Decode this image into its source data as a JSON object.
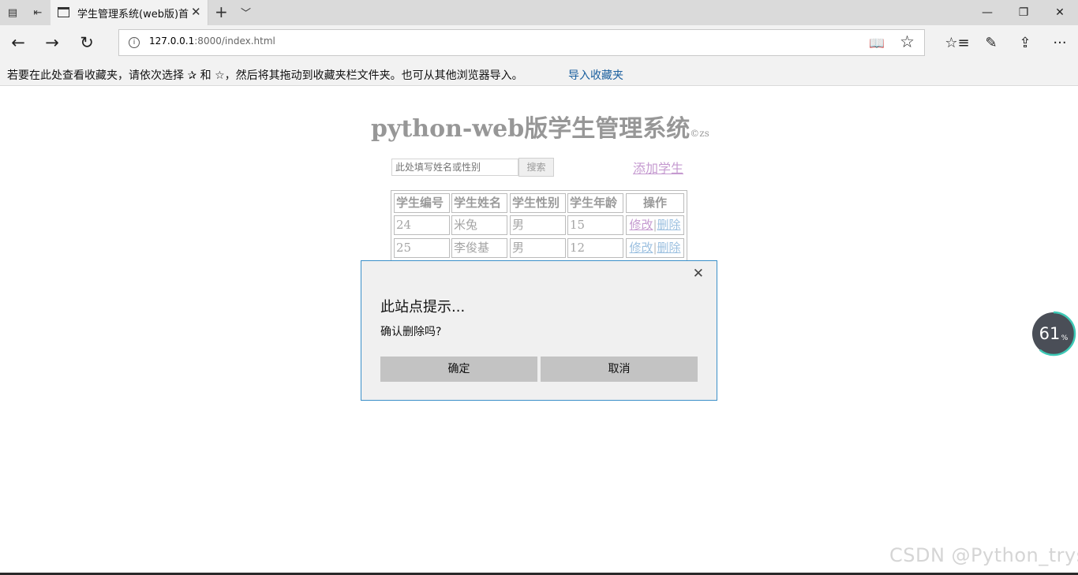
{
  "browser": {
    "tab_title": "学生管理系统(web版)首",
    "url_host": "127.0.0.1",
    "url_rest": ":8000/index.html",
    "address_info_icon": "i"
  },
  "favorites_bar": {
    "text": "若要在此处查看收藏夹，请依次选择 ✰ 和 ☆，然后将其拖动到收藏夹栏文件夹。也可从其他浏览器导入。",
    "import_link": "导入收藏夹"
  },
  "page": {
    "title": "python-web版学生管理系统",
    "title_suffix": "©zs",
    "search_placeholder": "此处填写姓名或性别",
    "search_button": "搜索",
    "add_student_link": "添加学生",
    "table": {
      "headers": [
        "学生编号",
        "学生姓名",
        "学生性别",
        "学生年龄",
        "操作"
      ],
      "rows": [
        {
          "id": "24",
          "name": "米兔",
          "gender": "男",
          "age": "15",
          "edit": "修改",
          "delete": "删除"
        },
        {
          "id": "25",
          "name": "李俊基",
          "gender": "男",
          "age": "12",
          "edit": "修改",
          "delete": "删除"
        }
      ]
    }
  },
  "dialog": {
    "title": "此站点提示...",
    "message": "确认删除吗?",
    "ok_button": "确定",
    "cancel_button": "取消"
  },
  "overlay": {
    "meter_value": "61",
    "meter_unit": "%",
    "meter_fraction": 0.61,
    "watermark": "CSDN @Python_trys"
  },
  "colors": {
    "dialog_border": "#3b8fc8",
    "link_visited": "#c59ad0",
    "link": "#9cc0e0",
    "meter_ring": "#3ec9b6"
  }
}
